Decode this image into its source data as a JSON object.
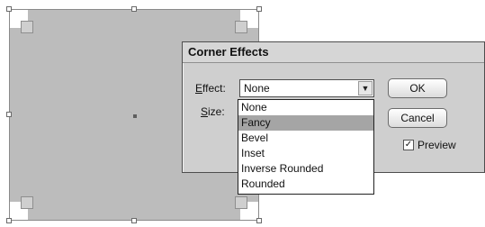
{
  "dialog": {
    "title": "Corner Effects",
    "effect_label": "Effect:",
    "effect_value": "None",
    "size_label": "Size:",
    "ok_label": "OK",
    "cancel_label": "Cancel",
    "preview_label": "Preview",
    "preview_checked": true
  },
  "dropdown": {
    "items": [
      {
        "label": "None"
      },
      {
        "label": "Fancy"
      },
      {
        "label": "Bevel"
      },
      {
        "label": "Inset"
      },
      {
        "label": "Inverse Rounded"
      },
      {
        "label": "Rounded"
      }
    ],
    "selected": "Fancy"
  },
  "icons": {
    "dropdown_arrow": "chevron-down-icon",
    "check": "checkmark-icon"
  },
  "colors": {
    "shape_fill": "#bcbcbc",
    "dialog_bg": "#cfcfcf",
    "highlight": "#a5a5a5"
  }
}
